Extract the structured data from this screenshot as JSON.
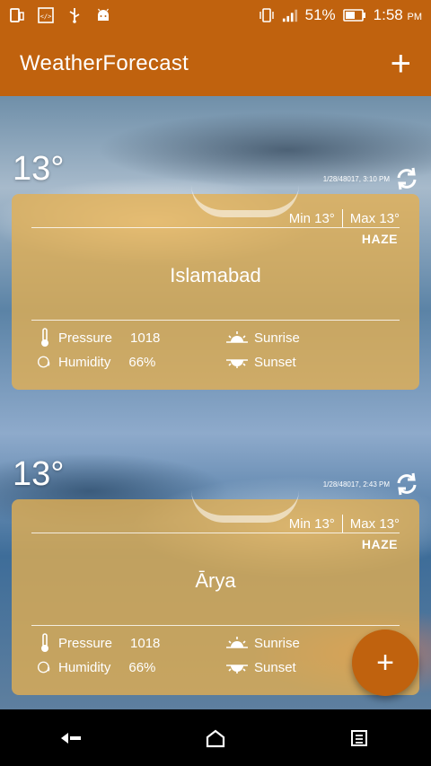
{
  "status_bar": {
    "battery_percent": "51%",
    "time": "1:58",
    "ampm": "PM",
    "icons": [
      "phone-icon",
      "code-icon",
      "usb-icon",
      "android-icon",
      "vibrate-icon",
      "signal-icon",
      "battery-icon"
    ]
  },
  "app_bar": {
    "title": "WeatherForecast",
    "add_label": "+"
  },
  "cards": [
    {
      "temperature": "13°",
      "timestamp": "1/28/48017, 3:10 PM",
      "min_label": "Min",
      "min_value": "13°",
      "max_label": "Max",
      "max_value": "13°",
      "condition": "HAZE",
      "city": "Islamabad",
      "pressure_label": "Pressure",
      "pressure_value": "1018",
      "humidity_label": "Humidity",
      "humidity_value": "66%",
      "sunrise_label": "Sunrise",
      "sunset_label": "Sunset"
    },
    {
      "temperature": "13°",
      "timestamp": "1/28/48017, 2:43 PM",
      "min_label": "Min",
      "min_value": "13°",
      "max_label": "Max",
      "max_value": "13°",
      "condition": "HAZE",
      "city": "Ārya",
      "pressure_label": "Pressure",
      "pressure_value": "1018",
      "humidity_label": "Humidity",
      "humidity_value": "66%",
      "sunrise_label": "Sunrise",
      "sunset_label": "Sunset"
    }
  ],
  "fab": {
    "label": "+"
  },
  "colors": {
    "primary": "#c0620e",
    "card": "#e6b050"
  }
}
